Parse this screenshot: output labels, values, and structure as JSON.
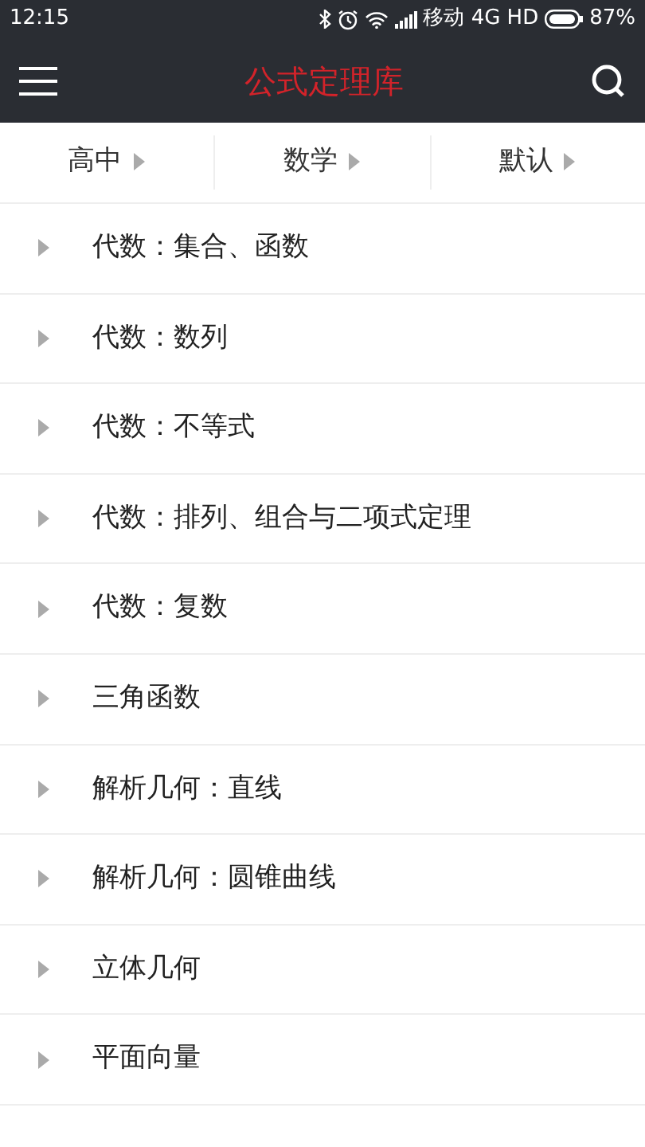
{
  "status_bar": {
    "time": "12:15",
    "carrier": "移动 4G HD",
    "battery": "87%"
  },
  "header": {
    "title": "公式定理库"
  },
  "filters": [
    {
      "label": "高中"
    },
    {
      "label": "数学"
    },
    {
      "label": "默认"
    }
  ],
  "items": [
    {
      "label": "代数：集合、函数",
      "expanded": false
    },
    {
      "label": "代数：数列",
      "expanded": false
    },
    {
      "label": "代数：不等式",
      "expanded": false
    },
    {
      "label": "代数：排列、组合与二项式定理",
      "expanded": false
    },
    {
      "label": "代数：复数",
      "expanded": false
    },
    {
      "label": "三角函数",
      "expanded": false
    },
    {
      "label": "解析几何：直线",
      "expanded": false
    },
    {
      "label": "解析几何：圆锥曲线",
      "expanded": false
    },
    {
      "label": "立体几何",
      "expanded": false
    },
    {
      "label": "平面向量",
      "expanded": false
    }
  ]
}
